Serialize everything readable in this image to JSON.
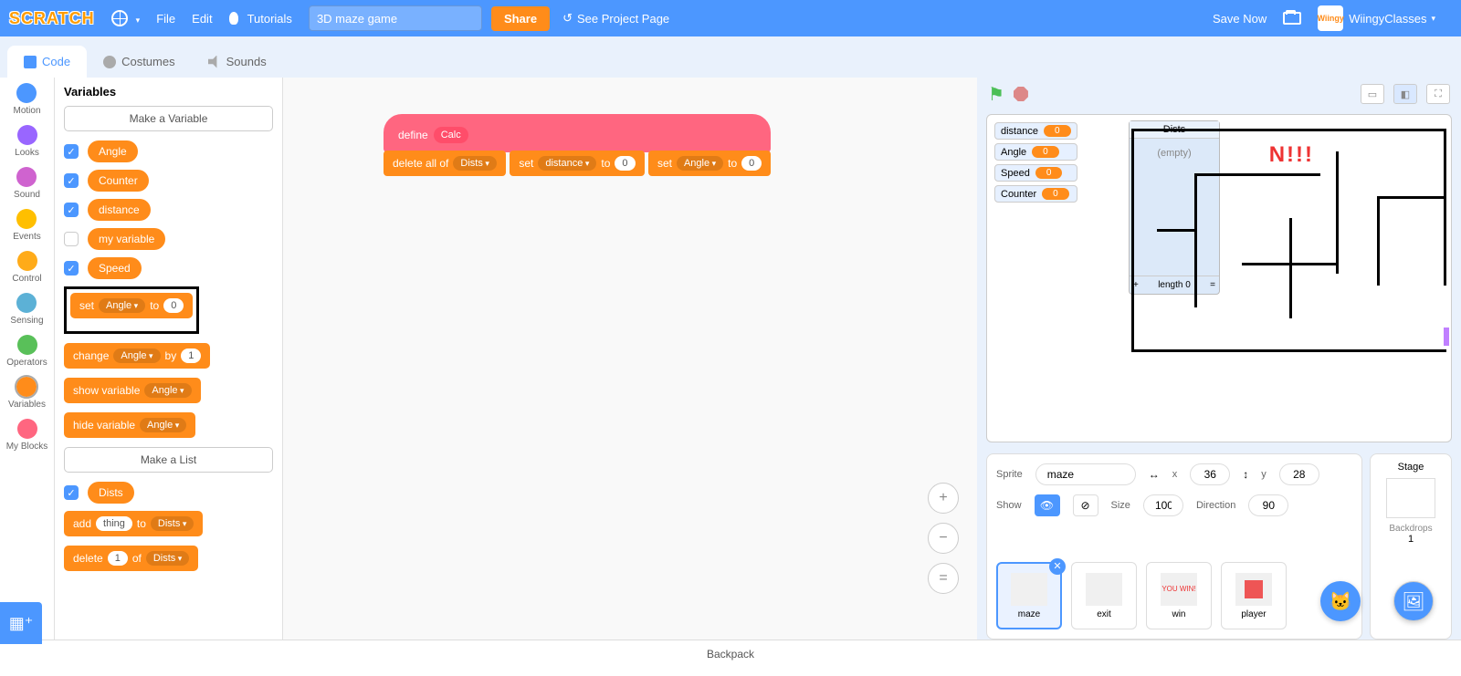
{
  "menu": {
    "logo": "SCRATCH",
    "file": "File",
    "edit": "Edit",
    "tutorials": "Tutorials",
    "project_title": "3D maze game",
    "share": "Share",
    "project_page": "See Project Page",
    "save_now": "Save Now",
    "username": "WiingyClasses"
  },
  "tabs": {
    "code": "Code",
    "costumes": "Costumes",
    "sounds": "Sounds"
  },
  "categories": [
    {
      "name": "Motion",
      "color": "#4c97ff"
    },
    {
      "name": "Looks",
      "color": "#9966ff"
    },
    {
      "name": "Sound",
      "color": "#cf63cf"
    },
    {
      "name": "Events",
      "color": "#ffbf00"
    },
    {
      "name": "Control",
      "color": "#ffab19"
    },
    {
      "name": "Sensing",
      "color": "#5cb1d6"
    },
    {
      "name": "Operators",
      "color": "#59c059"
    },
    {
      "name": "Variables",
      "color": "#ff8c1a"
    },
    {
      "name": "My Blocks",
      "color": "#ff6680"
    }
  ],
  "palette": {
    "header": "Variables",
    "make_variable": "Make a Variable",
    "vars": [
      {
        "label": "Angle",
        "checked": true
      },
      {
        "label": "Counter",
        "checked": true
      },
      {
        "label": "distance",
        "checked": true
      },
      {
        "label": "my variable",
        "checked": false
      },
      {
        "label": "Speed",
        "checked": true
      }
    ],
    "set_block": {
      "pre": "set",
      "var": "Angle",
      "mid": "to",
      "val": "0"
    },
    "change_block": {
      "pre": "change",
      "var": "Angle",
      "mid": "by",
      "val": "1"
    },
    "show_block": {
      "pre": "show variable",
      "var": "Angle"
    },
    "hide_block": {
      "pre": "hide variable",
      "var": "Angle"
    },
    "make_list": "Make a List",
    "lists": [
      {
        "label": "Dists",
        "checked": true
      }
    ],
    "add_block": {
      "pre": "add",
      "val": "thing",
      "mid": "to",
      "list": "Dists"
    },
    "delete_block": {
      "pre": "delete",
      "val": "1",
      "mid": "of",
      "list": "Dists"
    }
  },
  "scripts": {
    "define": {
      "word": "define",
      "name": "Calc"
    },
    "delete_all": {
      "pre": "delete all of",
      "list": "Dists"
    },
    "set1": {
      "pre": "set",
      "var": "distance",
      "mid": "to",
      "val": "0"
    },
    "set2": {
      "pre": "set",
      "var": "Angle",
      "mid": "to",
      "val": "0"
    }
  },
  "stage": {
    "monitors": [
      {
        "name": "distance",
        "val": "0"
      },
      {
        "name": "Angle",
        "val": "0"
      },
      {
        "name": "Speed",
        "val": "0"
      },
      {
        "name": "Counter",
        "val": "0"
      }
    ],
    "list": {
      "name": "Dists",
      "empty": "(empty)",
      "length": "length 0"
    },
    "text_hint": "N!!!"
  },
  "sprite_info": {
    "sprite_label": "Sprite",
    "sprite_name": "maze",
    "x_label": "x",
    "x": "36",
    "y_label": "y",
    "y": "28",
    "show_label": "Show",
    "size_label": "Size",
    "size": "100",
    "dir_label": "Direction",
    "dir": "90"
  },
  "sprites": [
    {
      "name": "maze",
      "sel": true
    },
    {
      "name": "exit",
      "sel": false
    },
    {
      "name": "win",
      "sel": false,
      "txt": "YOU WIN!"
    },
    {
      "name": "player",
      "sel": false
    }
  ],
  "stage_panel": {
    "title": "Stage",
    "backdrops": "Backdrops",
    "count": "1"
  },
  "backpack": "Backpack"
}
